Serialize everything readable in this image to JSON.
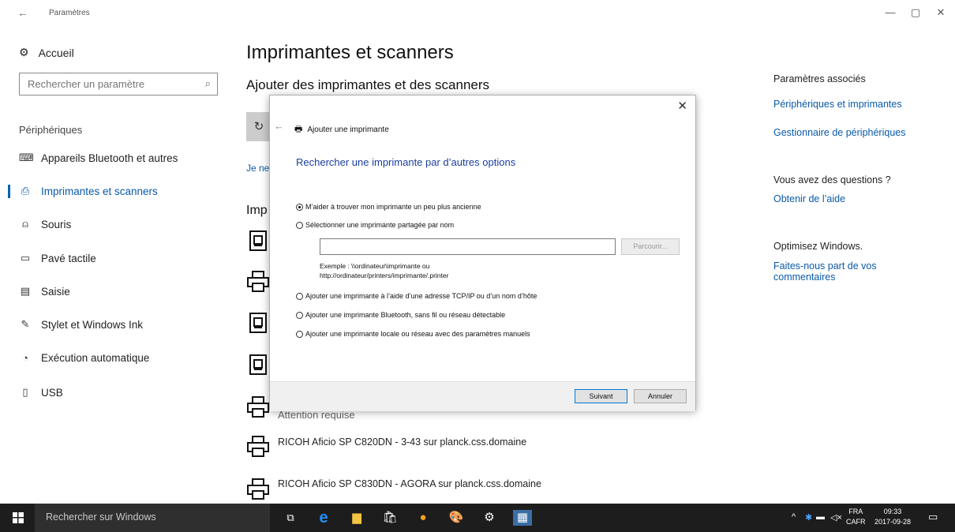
{
  "window": {
    "title": "Paramètres",
    "back": "←",
    "minimize": "—",
    "restore": "▢",
    "close": "✕"
  },
  "sidebar": {
    "home_label": "Accueil",
    "search_placeholder": "Rechercher un paramètre",
    "section_label": "Périphériques",
    "items": [
      {
        "label": "Appareils Bluetooth et autres",
        "icon": "keyboard-device-icon"
      },
      {
        "label": "Imprimantes et scanners",
        "icon": "printer-icon",
        "active": true
      },
      {
        "label": "Souris",
        "icon": "mouse-icon"
      },
      {
        "label": "Pavé tactile",
        "icon": "touchpad-icon"
      },
      {
        "label": "Saisie",
        "icon": "keyboard-icon"
      },
      {
        "label": "Stylet et Windows Ink",
        "icon": "pen-icon"
      },
      {
        "label": "Exécution automatique",
        "icon": "autoplay-icon"
      },
      {
        "label": "USB",
        "icon": "usb-icon"
      }
    ]
  },
  "main": {
    "title": "Imprimantes et scanners",
    "add_section_title": "Ajouter des imprimantes et des scanners",
    "link_partial": "Je ne",
    "printers_partial_title": "Imp",
    "attention_text": "Attention requise",
    "printers": [
      "RICOH Aficio SP C820DN - 3-43 sur planck.css.domaine",
      "RICOH Aficio SP C830DN - AGORA sur planck.css.domaine"
    ]
  },
  "right_panel": {
    "related_heading": "Paramètres associés",
    "related_links": [
      "Périphériques et imprimantes",
      "Gestionnaire de périphériques"
    ],
    "questions_heading": "Vous avez des questions ?",
    "help_link": "Obtenir de l’aide",
    "optimize_heading": "Optimisez Windows.",
    "feedback_link_line1": "Faites-nous part de vos",
    "feedback_link_line2": "commentaires"
  },
  "dialog": {
    "title": "Ajouter une imprimante",
    "heading": "Rechercher une imprimante par d’autres options",
    "options": [
      {
        "label": "M’aider à trouver mon imprimante un peu plus ancienne",
        "selected": true
      },
      {
        "label": "Sélectionner une imprimante partagée par nom",
        "selected": false
      },
      {
        "label": "Ajouter une imprimante à l’aide d’une adresse TCP/IP ou d’un nom d’hôte",
        "selected": false
      },
      {
        "label": "Ajouter une imprimante Bluetooth, sans fil ou réseau détectable",
        "selected": false
      },
      {
        "label": "Ajouter une imprimante locale ou réseau avec des paramètres manuels",
        "selected": false
      }
    ],
    "share_input_value": "",
    "browse_label": "Parcourir...",
    "example_line1": "Exemple : \\\\ordinateur\\imprimante ou",
    "example_line2": "http://ordinateur/printers/imprimante/.printer",
    "next_label": "Suivant",
    "cancel_label": "Annuler"
  },
  "taskbar": {
    "search_placeholder": "Rechercher sur Windows",
    "language_top": "FRA",
    "language_bottom": "CAFR",
    "time": "09:33",
    "date": "2017-09-28"
  },
  "colors": {
    "accent": "#0063b1",
    "link": "#0a5aa8",
    "taskbar": "#1d1d1d"
  }
}
